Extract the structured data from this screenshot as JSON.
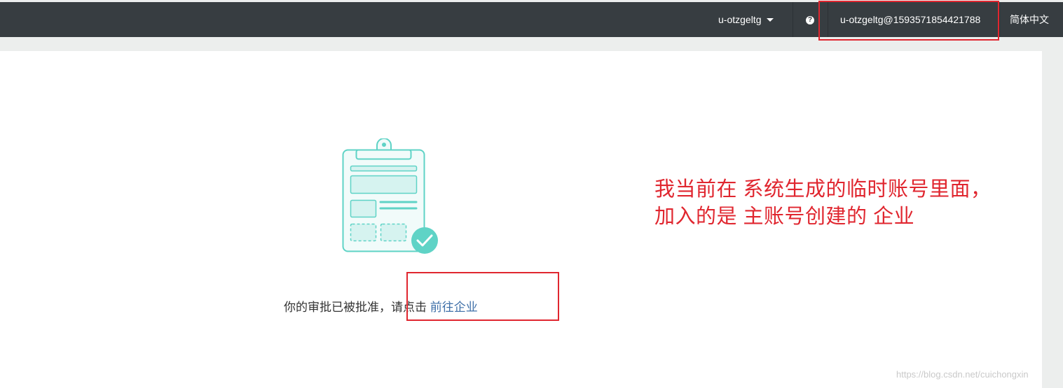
{
  "topbar": {
    "username": "u-otzgeltg",
    "help_glyph": "?",
    "account": "u-otzgeltg@1593571854421788",
    "language": "简体中文"
  },
  "main": {
    "message": "你的审批已被批准，请点击",
    "link_label": "前往企业"
  },
  "annotation": {
    "line1": "我当前在 系统生成的临时账号里面，",
    "line2": "加入的是 主账号创建的 企业"
  },
  "watermark": "https://blog.csdn.net/cuichongxin",
  "colors": {
    "topbar": "#373d41",
    "illustration": "#5fd3c6",
    "link": "#3e6fa8",
    "annotation": "#e0262f"
  },
  "icons": [
    "chevron-down-icon",
    "help-icon",
    "clipboard-check-illustration"
  ]
}
